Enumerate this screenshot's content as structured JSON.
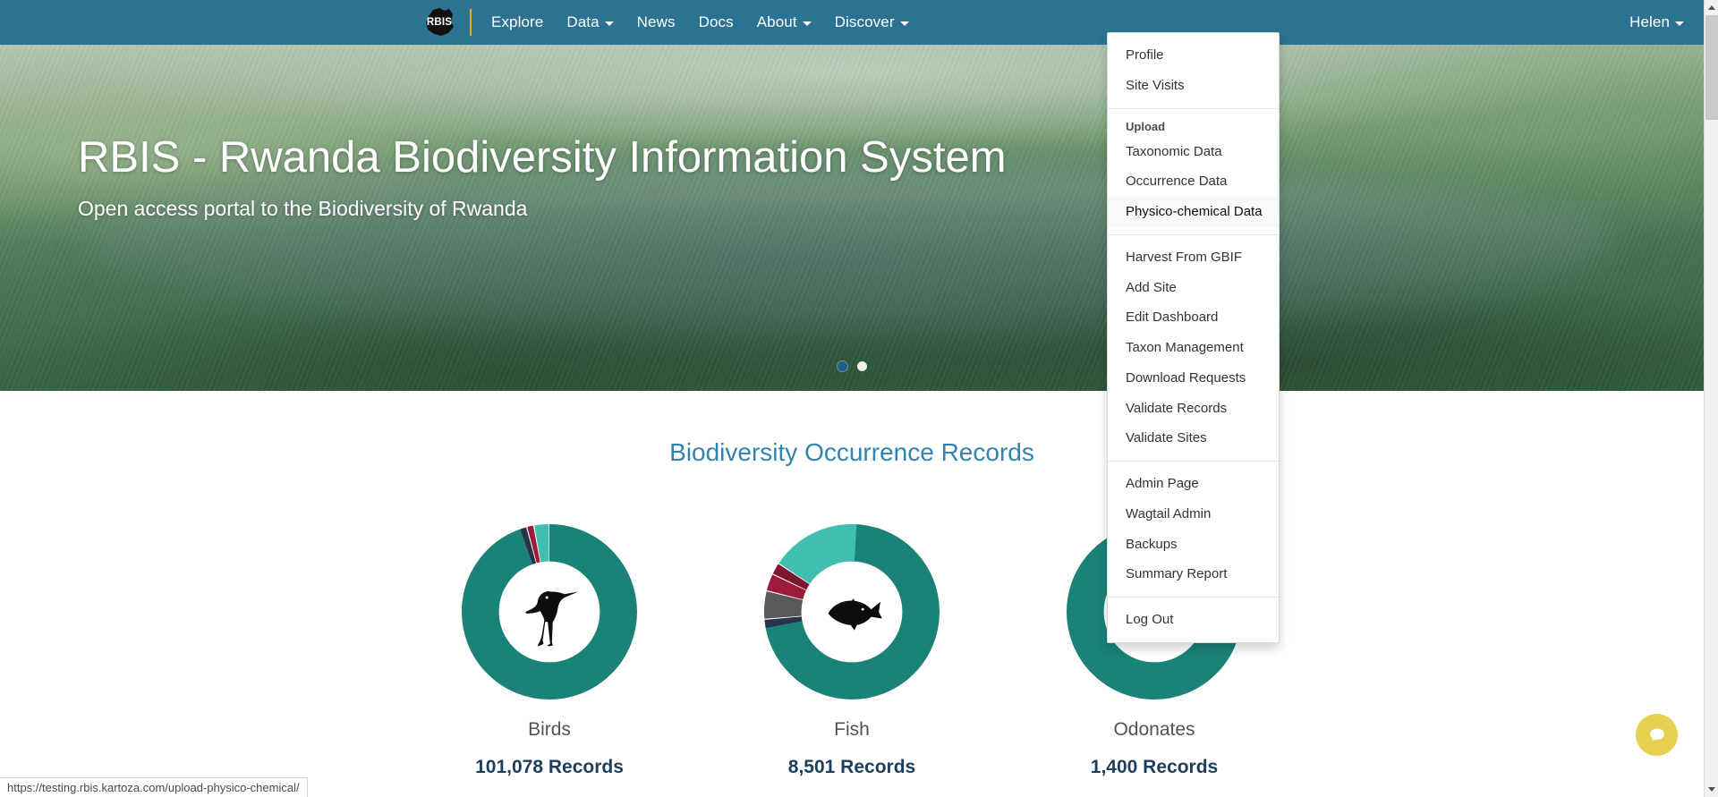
{
  "navbar": {
    "logo_text": "RBIS",
    "links": [
      {
        "label": "Explore",
        "has_caret": false
      },
      {
        "label": "Data",
        "has_caret": true
      },
      {
        "label": "News",
        "has_caret": false
      },
      {
        "label": "Docs",
        "has_caret": false
      },
      {
        "label": "About",
        "has_caret": true
      },
      {
        "label": "Discover",
        "has_caret": true
      }
    ],
    "user": "Helen",
    "bg_color": "#2b7391",
    "divider_color": "#d9b23a"
  },
  "hero": {
    "title": "RBIS - Rwanda Biodiversity Information System",
    "subtitle": "Open access portal to the Biodiversity of Rwanda",
    "dots": [
      {
        "state": "active"
      },
      {
        "state": "inactive"
      }
    ]
  },
  "user_menu": {
    "items": [
      {
        "type": "link",
        "label": "Profile",
        "active": false
      },
      {
        "type": "link",
        "label": "Site Visits",
        "active": false
      },
      {
        "type": "divider"
      },
      {
        "type": "header",
        "label": "Upload"
      },
      {
        "type": "link",
        "label": "Taxonomic Data",
        "active": false
      },
      {
        "type": "link",
        "label": "Occurrence Data",
        "active": false
      },
      {
        "type": "link",
        "label": "Physico-chemical Data",
        "active": true
      },
      {
        "type": "divider"
      },
      {
        "type": "link",
        "label": "Harvest From GBIF",
        "active": false
      },
      {
        "type": "link",
        "label": "Add Site",
        "active": false
      },
      {
        "type": "link",
        "label": "Edit Dashboard",
        "active": false
      },
      {
        "type": "link",
        "label": "Taxon Management",
        "active": false
      },
      {
        "type": "link",
        "label": "Download Requests",
        "active": false
      },
      {
        "type": "link",
        "label": "Validate Records",
        "active": false
      },
      {
        "type": "link",
        "label": "Validate Sites",
        "active": false
      },
      {
        "type": "divider"
      },
      {
        "type": "link",
        "label": "Admin Page",
        "active": false
      },
      {
        "type": "link",
        "label": "Wagtail Admin",
        "active": false
      },
      {
        "type": "link",
        "label": "Backups",
        "active": false
      },
      {
        "type": "link",
        "label": "Summary Report",
        "active": false
      },
      {
        "type": "divider"
      },
      {
        "type": "link",
        "label": "Log Out",
        "active": false
      }
    ]
  },
  "main": {
    "section_title": "Biodiversity Occurrence Records"
  },
  "chart_data": {
    "type": "pie",
    "title": "Biodiversity Occurrence Records",
    "legend": "none",
    "charts": [
      {
        "label": "Birds",
        "count_label": "101,078 Records",
        "icon": "bird-icon",
        "slices": [
          {
            "name": "primary",
            "value": 94.5,
            "color": "#1a8277"
          },
          {
            "name": "navy",
            "value": 1.2,
            "color": "#26334a"
          },
          {
            "name": "crimson",
            "value": 1.1,
            "color": "#9c1b3a"
          },
          {
            "name": "light-teal",
            "value": 3.2,
            "color": "#40bfb0"
          }
        ]
      },
      {
        "label": "Fish",
        "count_label": "8,501 Records",
        "icon": "fish-icon",
        "slices": [
          {
            "name": "primary",
            "value": 72.0,
            "color": "#1a8277"
          },
          {
            "name": "navy",
            "value": 1.5,
            "color": "#26334a"
          },
          {
            "name": "gray",
            "value": 5.0,
            "color": "#595959"
          },
          {
            "name": "crimson",
            "value": 3.0,
            "color": "#9c1b3a"
          },
          {
            "name": "dark-red",
            "value": 2.0,
            "color": "#7d1730"
          },
          {
            "name": "light-teal",
            "value": 16.5,
            "color": "#40bfb0"
          }
        ]
      },
      {
        "label": "Odonates",
        "count_label": "1,400 Records",
        "icon": "dragonfly-icon",
        "slices": [
          {
            "name": "primary",
            "value": 97.0,
            "color": "#1a8277"
          },
          {
            "name": "gap",
            "value": 3.0,
            "color": "#ffffff"
          }
        ]
      }
    ]
  },
  "chat": {
    "icon": "chat-bubble-icon",
    "color": "#e7d04f"
  },
  "status_bar": {
    "url": "https://testing.rbis.kartoza.com/upload-physico-chemical/"
  }
}
